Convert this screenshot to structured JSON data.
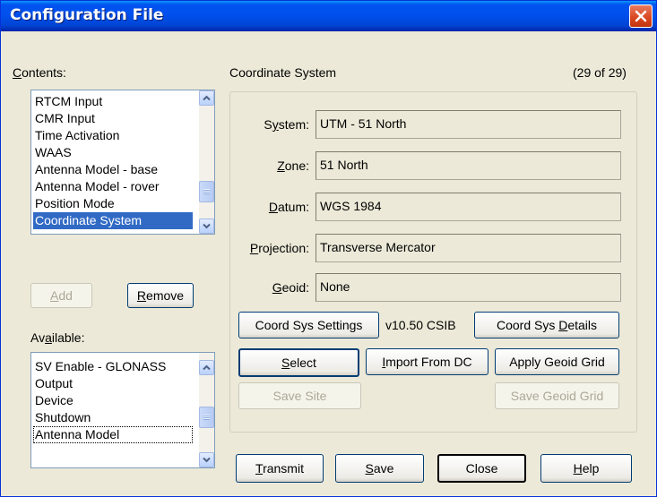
{
  "window": {
    "title": "Configuration File"
  },
  "contents": {
    "label": "Contents:",
    "label_key": "C",
    "label_rest": "ontents:",
    "items": [
      {
        "label": "RTCM Input"
      },
      {
        "label": "CMR Input"
      },
      {
        "label": "Time Activation"
      },
      {
        "label": "WAAS"
      },
      {
        "label": "Antenna Model - base"
      },
      {
        "label": "Antenna Model - rover"
      },
      {
        "label": "Position Mode"
      },
      {
        "label": "Coordinate System"
      }
    ],
    "selected_index": 7
  },
  "add_button": {
    "label": "Add",
    "key": "A",
    "rest": "dd"
  },
  "remove_button": {
    "label": "Remove",
    "key": "R",
    "rest": "emove"
  },
  "available": {
    "label": "Available:",
    "label_pre": "Av",
    "label_key": "a",
    "label_rest": "ilable:",
    "items": [
      {
        "label": "SV Enable - GLONASS"
      },
      {
        "label": "Output"
      },
      {
        "label": "Device"
      },
      {
        "label": "Shutdown"
      },
      {
        "label": "Antenna Model"
      }
    ],
    "focused_index": 4
  },
  "section": {
    "title": "Coordinate System",
    "counter": "(29 of 29)"
  },
  "fields": {
    "system": {
      "label": "System:",
      "pre": "S",
      "key": "y",
      "rest": "stem:",
      "value": "UTM - 51 North"
    },
    "zone": {
      "label": "Zone:",
      "key": "Z",
      "rest": "one:",
      "value": "51 North"
    },
    "datum": {
      "label": "Datum:",
      "key": "D",
      "rest": "atum:",
      "value": "WGS 1984"
    },
    "projection": {
      "label": "Projection:",
      "key": "P",
      "rest": "rojection:",
      "value": "Transverse Mercator"
    },
    "geoid": {
      "label": "Geoid:",
      "key": "G",
      "rest": "eoid:",
      "value": "None"
    }
  },
  "buttons": {
    "coord_sys_settings": "Coord Sys Settings",
    "version": "v10.50 CSIB",
    "coord_sys_details_pre": "Coord Sys ",
    "coord_sys_details_key": "D",
    "coord_sys_details_rest": "etails",
    "select_key": "S",
    "select_rest": "elect",
    "import_pre": "I",
    "import_rest": "mport From DC",
    "apply_geoid_grid": "Apply Geoid Grid",
    "save_site": "Save Site",
    "save_geoid_grid": "Save Geoid Grid"
  },
  "footer": {
    "transmit_key": "T",
    "transmit_rest": "ransmit",
    "save_key": "S",
    "save_rest": "ave",
    "close": "Close",
    "help_key": "H",
    "help_rest": "elp"
  },
  "colors": {
    "titlebar": "#0053ee",
    "selection": "#316ac5",
    "close_button": "#d9451e",
    "dialog_face": "#ece9d8"
  }
}
